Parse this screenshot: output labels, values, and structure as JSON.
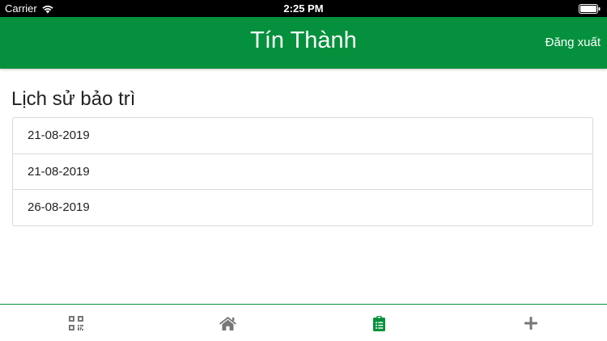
{
  "status_bar": {
    "carrier": "Carrier",
    "time": "2:25 PM"
  },
  "header": {
    "title": "Tín Thành",
    "logout_label": "Đăng xuất",
    "background_color": "#04903c"
  },
  "main": {
    "section_title": "Lịch sử bảo trì",
    "history": [
      {
        "date": "21-08-2019"
      },
      {
        "date": "21-08-2019"
      },
      {
        "date": "26-08-2019"
      }
    ]
  },
  "tab_bar": {
    "tabs": [
      {
        "icon": "qrcode-icon",
        "active": false
      },
      {
        "icon": "home-icon",
        "active": false
      },
      {
        "icon": "clipboard-list-icon",
        "active": true
      },
      {
        "icon": "plus-icon",
        "active": false
      }
    ],
    "active_color": "#04903c",
    "inactive_color": "#777777"
  }
}
